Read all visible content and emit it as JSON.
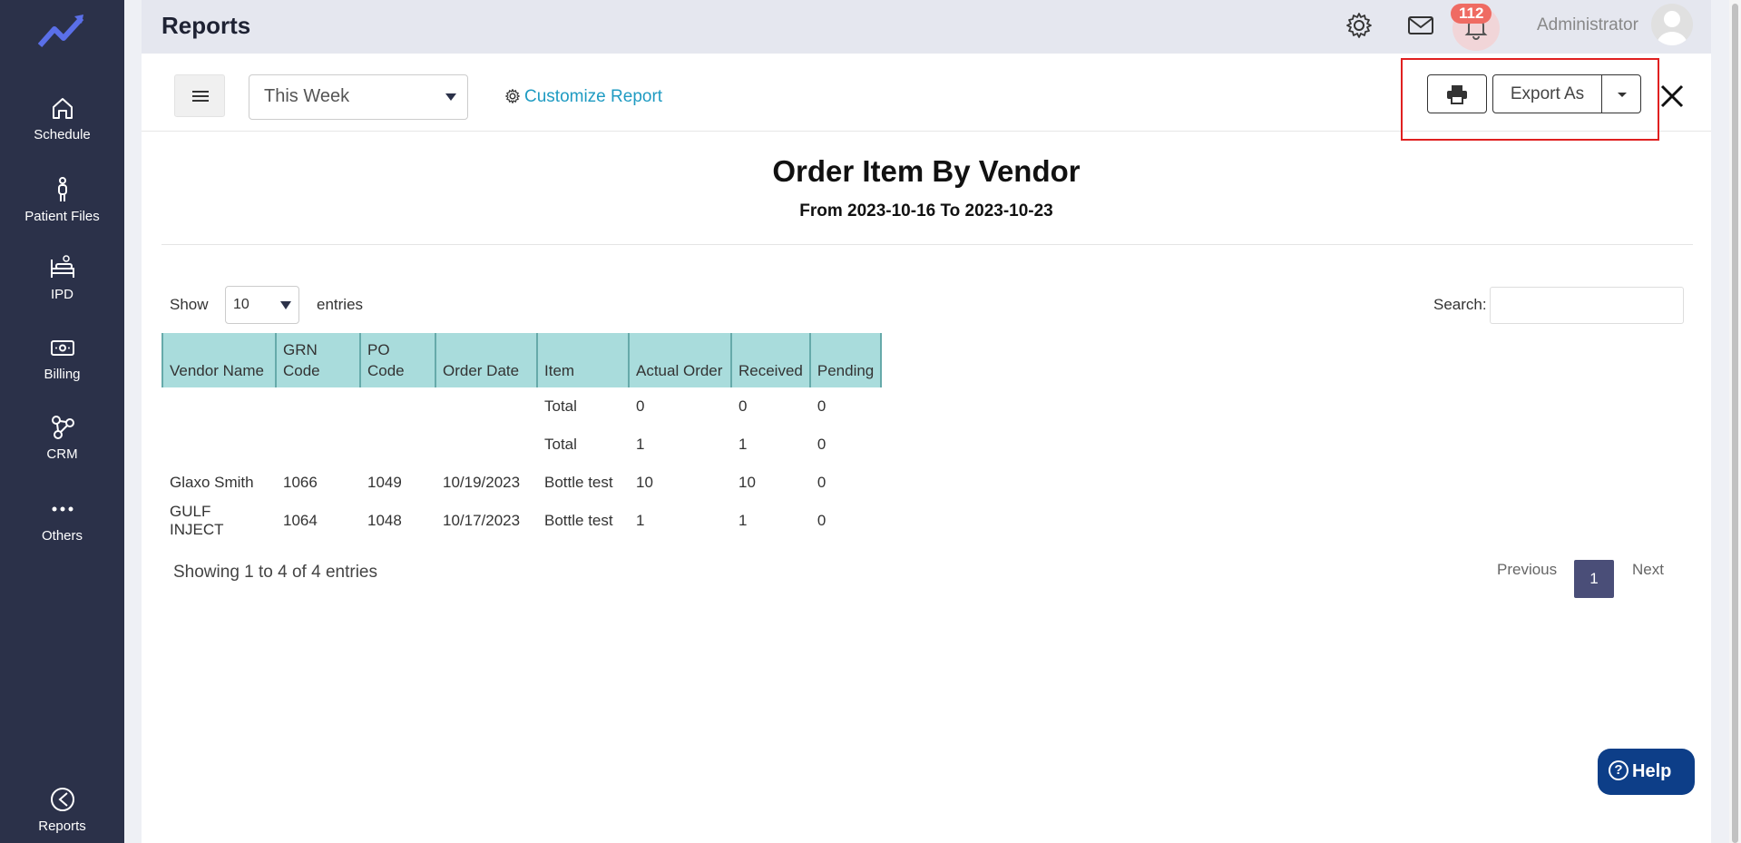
{
  "sidebar": {
    "items": [
      {
        "label": "Schedule",
        "icon": "home-icon"
      },
      {
        "label": "Patient Files",
        "icon": "person-icon"
      },
      {
        "label": "IPD",
        "icon": "bed-icon"
      },
      {
        "label": "Billing",
        "icon": "cash-icon"
      },
      {
        "label": "CRM",
        "icon": "network-icon"
      },
      {
        "label": "Others",
        "icon": "more-icon"
      },
      {
        "label": "Reports",
        "icon": "pie-chart-icon"
      }
    ]
  },
  "header": {
    "title": "Reports",
    "notification_count": "112",
    "user": "Administrator"
  },
  "toolbar": {
    "period": "This Week",
    "customize_label": "Customize Report",
    "export_label": "Export As"
  },
  "report": {
    "title": "Order Item By Vendor",
    "range": "From 2023-10-16 To 2023-10-23"
  },
  "table_controls": {
    "show_label": "Show",
    "entries_value": "10",
    "entries_label": "entries",
    "search_label": "Search:"
  },
  "table": {
    "columns": [
      "Vendor Name",
      "GRN Code",
      "PO Code",
      "Order Date",
      "Item",
      "Actual Order",
      "Received",
      "Pending"
    ],
    "rows": [
      [
        "",
        "",
        "",
        "",
        "Total",
        "0",
        "0",
        "0"
      ],
      [
        "",
        "",
        "",
        "",
        "Total",
        "1",
        "1",
        "0"
      ],
      [
        "Glaxo Smith",
        "1066",
        "1049",
        "10/19/2023",
        "Bottle test",
        "10",
        "10",
        "0"
      ],
      [
        "GULF INJECT",
        "1064",
        "1048",
        "10/17/2023",
        "Bottle test",
        "1",
        "1",
        "0"
      ]
    ]
  },
  "pagination": {
    "summary": "Showing 1 to 4 of 4 entries",
    "previous": "Previous",
    "current": "1",
    "next": "Next"
  },
  "help_label": "Help",
  "colors": {
    "sidebar": "#2b3149",
    "accent_link": "#1f9bc2",
    "table_header": "#a9dcdc",
    "highlight": "#e02020",
    "help": "#0d3e88"
  }
}
